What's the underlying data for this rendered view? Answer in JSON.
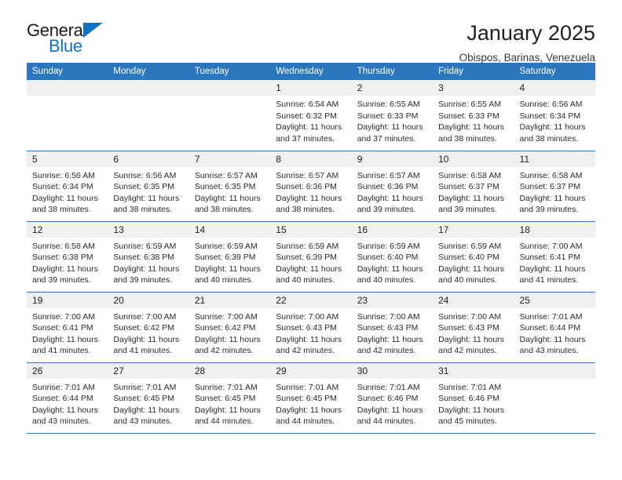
{
  "brand": {
    "name_top": "General",
    "name_bottom": "Blue",
    "triangle_icon": "triangle-icon",
    "accent_color": "#1273c4"
  },
  "header": {
    "title": "January 2025",
    "location": "Obispos, Barinas, Venezuela"
  },
  "theme": {
    "header_bg": "#2c76bd",
    "daynum_bg": "#f0f0f0",
    "text_color": "#222222"
  },
  "calendar": {
    "weekday_headers": [
      "Sunday",
      "Monday",
      "Tuesday",
      "Wednesday",
      "Thursday",
      "Friday",
      "Saturday"
    ],
    "weeks": [
      [
        {
          "day": "",
          "empty": true
        },
        {
          "day": "",
          "empty": true
        },
        {
          "day": "",
          "empty": true
        },
        {
          "day": "1",
          "sunrise": "Sunrise: 6:54 AM",
          "sunset": "Sunset: 6:32 PM",
          "daylight1": "Daylight: 11 hours",
          "daylight2": "and 37 minutes."
        },
        {
          "day": "2",
          "sunrise": "Sunrise: 6:55 AM",
          "sunset": "Sunset: 6:33 PM",
          "daylight1": "Daylight: 11 hours",
          "daylight2": "and 37 minutes."
        },
        {
          "day": "3",
          "sunrise": "Sunrise: 6:55 AM",
          "sunset": "Sunset: 6:33 PM",
          "daylight1": "Daylight: 11 hours",
          "daylight2": "and 38 minutes."
        },
        {
          "day": "4",
          "sunrise": "Sunrise: 6:56 AM",
          "sunset": "Sunset: 6:34 PM",
          "daylight1": "Daylight: 11 hours",
          "daylight2": "and 38 minutes."
        }
      ],
      [
        {
          "day": "5",
          "sunrise": "Sunrise: 6:56 AM",
          "sunset": "Sunset: 6:34 PM",
          "daylight1": "Daylight: 11 hours",
          "daylight2": "and 38 minutes."
        },
        {
          "day": "6",
          "sunrise": "Sunrise: 6:56 AM",
          "sunset": "Sunset: 6:35 PM",
          "daylight1": "Daylight: 11 hours",
          "daylight2": "and 38 minutes."
        },
        {
          "day": "7",
          "sunrise": "Sunrise: 6:57 AM",
          "sunset": "Sunset: 6:35 PM",
          "daylight1": "Daylight: 11 hours",
          "daylight2": "and 38 minutes."
        },
        {
          "day": "8",
          "sunrise": "Sunrise: 6:57 AM",
          "sunset": "Sunset: 6:36 PM",
          "daylight1": "Daylight: 11 hours",
          "daylight2": "and 38 minutes."
        },
        {
          "day": "9",
          "sunrise": "Sunrise: 6:57 AM",
          "sunset": "Sunset: 6:36 PM",
          "daylight1": "Daylight: 11 hours",
          "daylight2": "and 39 minutes."
        },
        {
          "day": "10",
          "sunrise": "Sunrise: 6:58 AM",
          "sunset": "Sunset: 6:37 PM",
          "daylight1": "Daylight: 11 hours",
          "daylight2": "and 39 minutes."
        },
        {
          "day": "11",
          "sunrise": "Sunrise: 6:58 AM",
          "sunset": "Sunset: 6:37 PM",
          "daylight1": "Daylight: 11 hours",
          "daylight2": "and 39 minutes."
        }
      ],
      [
        {
          "day": "12",
          "sunrise": "Sunrise: 6:58 AM",
          "sunset": "Sunset: 6:38 PM",
          "daylight1": "Daylight: 11 hours",
          "daylight2": "and 39 minutes."
        },
        {
          "day": "13",
          "sunrise": "Sunrise: 6:59 AM",
          "sunset": "Sunset: 6:38 PM",
          "daylight1": "Daylight: 11 hours",
          "daylight2": "and 39 minutes."
        },
        {
          "day": "14",
          "sunrise": "Sunrise: 6:59 AM",
          "sunset": "Sunset: 6:39 PM",
          "daylight1": "Daylight: 11 hours",
          "daylight2": "and 40 minutes."
        },
        {
          "day": "15",
          "sunrise": "Sunrise: 6:59 AM",
          "sunset": "Sunset: 6:39 PM",
          "daylight1": "Daylight: 11 hours",
          "daylight2": "and 40 minutes."
        },
        {
          "day": "16",
          "sunrise": "Sunrise: 6:59 AM",
          "sunset": "Sunset: 6:40 PM",
          "daylight1": "Daylight: 11 hours",
          "daylight2": "and 40 minutes."
        },
        {
          "day": "17",
          "sunrise": "Sunrise: 6:59 AM",
          "sunset": "Sunset: 6:40 PM",
          "daylight1": "Daylight: 11 hours",
          "daylight2": "and 40 minutes."
        },
        {
          "day": "18",
          "sunrise": "Sunrise: 7:00 AM",
          "sunset": "Sunset: 6:41 PM",
          "daylight1": "Daylight: 11 hours",
          "daylight2": "and 41 minutes."
        }
      ],
      [
        {
          "day": "19",
          "sunrise": "Sunrise: 7:00 AM",
          "sunset": "Sunset: 6:41 PM",
          "daylight1": "Daylight: 11 hours",
          "daylight2": "and 41 minutes."
        },
        {
          "day": "20",
          "sunrise": "Sunrise: 7:00 AM",
          "sunset": "Sunset: 6:42 PM",
          "daylight1": "Daylight: 11 hours",
          "daylight2": "and 41 minutes."
        },
        {
          "day": "21",
          "sunrise": "Sunrise: 7:00 AM",
          "sunset": "Sunset: 6:42 PM",
          "daylight1": "Daylight: 11 hours",
          "daylight2": "and 42 minutes."
        },
        {
          "day": "22",
          "sunrise": "Sunrise: 7:00 AM",
          "sunset": "Sunset: 6:43 PM",
          "daylight1": "Daylight: 11 hours",
          "daylight2": "and 42 minutes."
        },
        {
          "day": "23",
          "sunrise": "Sunrise: 7:00 AM",
          "sunset": "Sunset: 6:43 PM",
          "daylight1": "Daylight: 11 hours",
          "daylight2": "and 42 minutes."
        },
        {
          "day": "24",
          "sunrise": "Sunrise: 7:00 AM",
          "sunset": "Sunset: 6:43 PM",
          "daylight1": "Daylight: 11 hours",
          "daylight2": "and 42 minutes."
        },
        {
          "day": "25",
          "sunrise": "Sunrise: 7:01 AM",
          "sunset": "Sunset: 6:44 PM",
          "daylight1": "Daylight: 11 hours",
          "daylight2": "and 43 minutes."
        }
      ],
      [
        {
          "day": "26",
          "sunrise": "Sunrise: 7:01 AM",
          "sunset": "Sunset: 6:44 PM",
          "daylight1": "Daylight: 11 hours",
          "daylight2": "and 43 minutes."
        },
        {
          "day": "27",
          "sunrise": "Sunrise: 7:01 AM",
          "sunset": "Sunset: 6:45 PM",
          "daylight1": "Daylight: 11 hours",
          "daylight2": "and 43 minutes."
        },
        {
          "day": "28",
          "sunrise": "Sunrise: 7:01 AM",
          "sunset": "Sunset: 6:45 PM",
          "daylight1": "Daylight: 11 hours",
          "daylight2": "and 44 minutes."
        },
        {
          "day": "29",
          "sunrise": "Sunrise: 7:01 AM",
          "sunset": "Sunset: 6:45 PM",
          "daylight1": "Daylight: 11 hours",
          "daylight2": "and 44 minutes."
        },
        {
          "day": "30",
          "sunrise": "Sunrise: 7:01 AM",
          "sunset": "Sunset: 6:46 PM",
          "daylight1": "Daylight: 11 hours",
          "daylight2": "and 44 minutes."
        },
        {
          "day": "31",
          "sunrise": "Sunrise: 7:01 AM",
          "sunset": "Sunset: 6:46 PM",
          "daylight1": "Daylight: 11 hours",
          "daylight2": "and 45 minutes."
        },
        {
          "day": "",
          "empty": true
        }
      ]
    ]
  }
}
